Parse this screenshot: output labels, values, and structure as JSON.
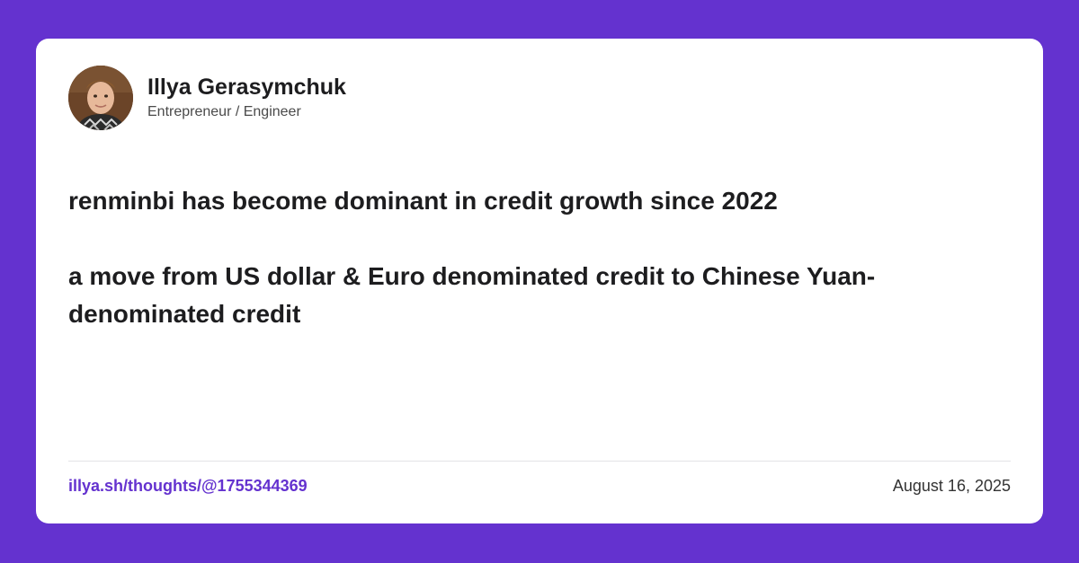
{
  "colors": {
    "background": "#6432CF",
    "card": "#FFFFFF",
    "accent_link": "#6432CF",
    "text_primary": "#1d1d1f",
    "text_secondary": "#4a4a4a"
  },
  "author": {
    "avatar_icon": "avatar-photo",
    "name": "Illya Gerasymchuk",
    "role": "Entrepreneur / Engineer"
  },
  "post": {
    "paragraphs": [
      "renminbi has become dominant in credit growth since 2022",
      "a move from US dollar & Euro denominated credit to Chinese Yuan-denominated credit"
    ]
  },
  "footer": {
    "link": "illya.sh/thoughts/@1755344369",
    "date": "August 16, 2025"
  }
}
